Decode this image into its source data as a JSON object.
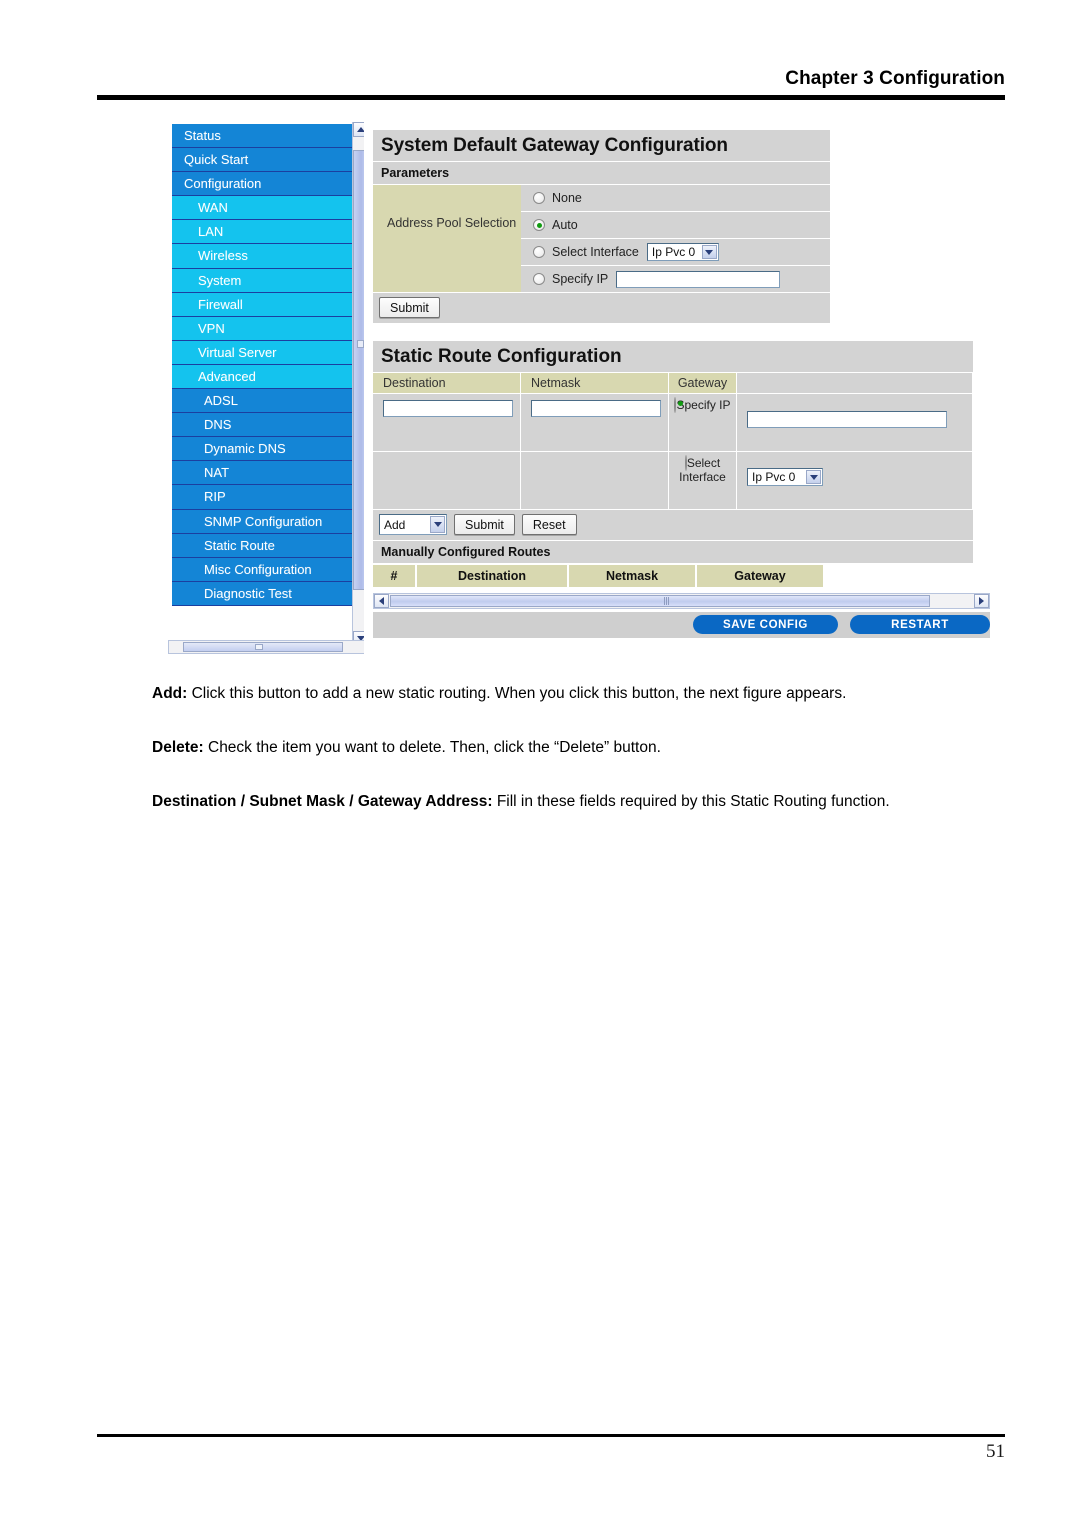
{
  "document": {
    "header_title": "Chapter 3 Configuration",
    "page_number": "51"
  },
  "figure": {
    "sidebar": {
      "items": [
        {
          "label": "Status",
          "level": "top"
        },
        {
          "label": "Quick Start",
          "level": "top"
        },
        {
          "label": "Configuration",
          "level": "top"
        },
        {
          "label": "WAN",
          "level": "sub"
        },
        {
          "label": "LAN",
          "level": "sub"
        },
        {
          "label": "Wireless",
          "level": "sub"
        },
        {
          "label": "System",
          "level": "sub"
        },
        {
          "label": "Firewall",
          "level": "sub"
        },
        {
          "label": "VPN",
          "level": "sub"
        },
        {
          "label": "Virtual Server",
          "level": "sub"
        },
        {
          "label": "Advanced",
          "level": "sub"
        },
        {
          "label": "ADSL",
          "level": "sub2"
        },
        {
          "label": "DNS",
          "level": "sub2"
        },
        {
          "label": "Dynamic DNS",
          "level": "sub2"
        },
        {
          "label": "NAT",
          "level": "sub2"
        },
        {
          "label": "RIP",
          "level": "sub2"
        },
        {
          "label": "SNMP Configuration",
          "level": "sub2"
        },
        {
          "label": "Static Route",
          "level": "sub2"
        },
        {
          "label": "Misc Configuration",
          "level": "sub2"
        },
        {
          "label": "Diagnostic Test",
          "level": "sub2"
        }
      ]
    },
    "gateway_panel": {
      "title": "System Default Gateway Configuration",
      "subtitle": "Parameters",
      "field_label": "Address Pool Selection",
      "options": {
        "none": "None",
        "auto": "Auto",
        "select_interface": "Select Interface",
        "specify_ip": "Specify IP"
      },
      "selected": "Auto",
      "interface_value": "Ip Pvc 0",
      "specify_ip_value": "",
      "submit_label": "Submit"
    },
    "static_route_panel": {
      "title": "Static Route Configuration",
      "headers": {
        "destination": "Destination",
        "netmask": "Netmask",
        "gateway": "Gateway"
      },
      "gateway_modes": {
        "specify_ip": "Specify IP",
        "select_interface": "Select Interface"
      },
      "gateway_selected": "Specify IP",
      "destination_value": "",
      "netmask_value": "",
      "gateway_ip_value": "",
      "interface_value": "Ip Pvc 0",
      "action_select_value": "Add",
      "submit_label": "Submit",
      "reset_label": "Reset",
      "routes_section_title": "Manually Configured Routes",
      "routes_columns": [
        "#",
        "Destination",
        "Netmask",
        "Gateway"
      ],
      "routes_rows": []
    },
    "action_bar": {
      "save_config_label": "SAVE CONFIG",
      "restart_label": "RESTART"
    },
    "colors": {
      "nav_top": "#1485d6",
      "nav_sub": "#14c3ee",
      "panel_bg": "#d3d3d3",
      "field_bg": "#d8d8b0",
      "button_blue": "#0a68c4",
      "radio_dot_green": "#119b11"
    }
  },
  "body": {
    "p1_term": "Add:",
    "p1_text": " Click this button to add a new static routing. When you click this button, the next figure appears.",
    "p2_term": "Delete:",
    "p2_text": " Check the item you want to delete. Then, click the “Delete” button.",
    "p3_term": "Destination / Subnet Mask / Gateway Address:",
    "p3_text": " Fill in these fields required by this Static Routing function."
  }
}
